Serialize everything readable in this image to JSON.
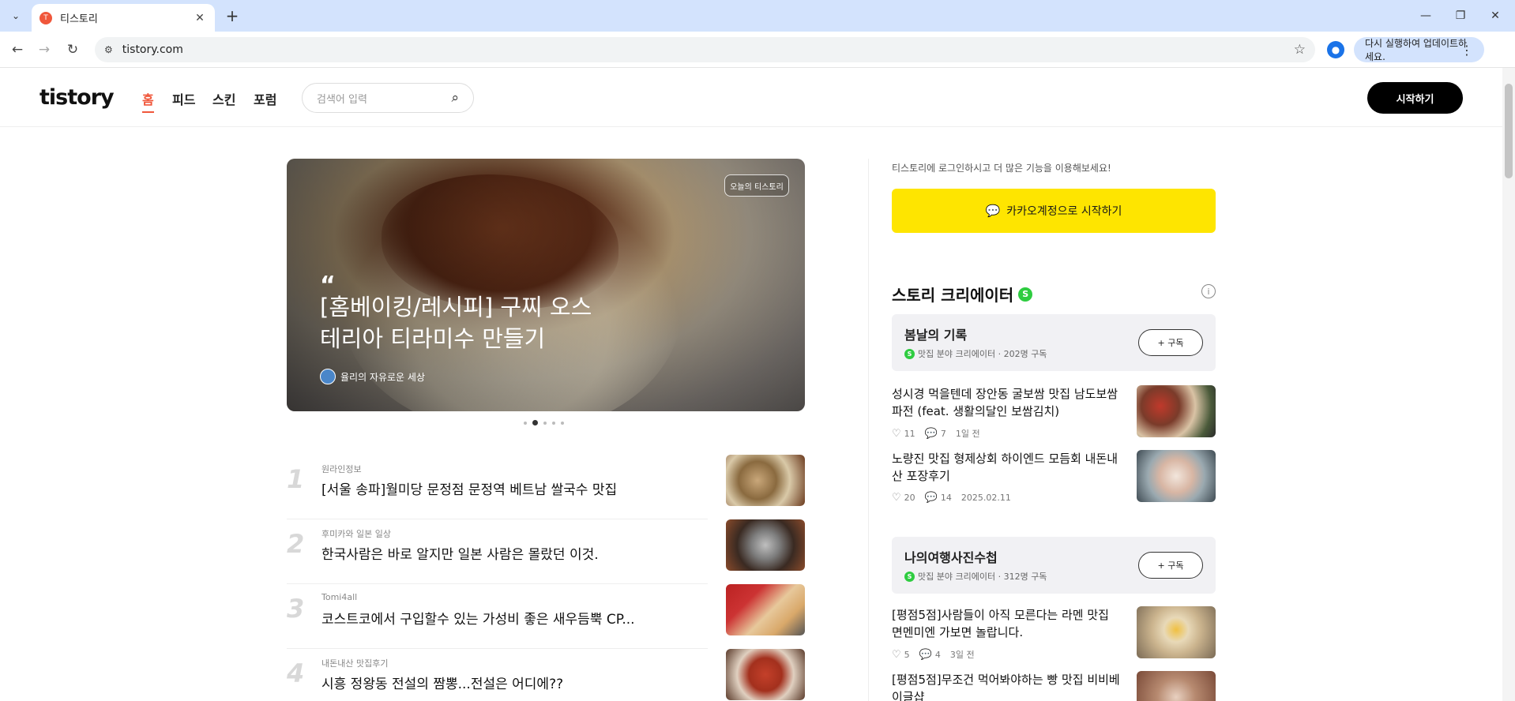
{
  "browser": {
    "tab_title": "티스토리",
    "url": "tistory.com",
    "update_label": "다시 실행하여 업데이트하세요."
  },
  "header": {
    "logo": "tistory",
    "nav": [
      "홈",
      "피드",
      "스킨",
      "포럼"
    ],
    "search_placeholder": "검색어 입력",
    "start_label": "시작하기"
  },
  "hero": {
    "badge": "오늘의 티스토리",
    "quote": "“",
    "title": "[홈베이킹/레시피] 구찌 오스테리아 티라미수 만들기",
    "author": "율리의 자유로운 세상",
    "slide_count": 5,
    "active_slide": 1
  },
  "ranking": [
    {
      "num": "1",
      "category": "원라인정보",
      "title": "[서울 송파]월미당 문정점 문정역 베트남 쌀국수 맛집"
    },
    {
      "num": "2",
      "category": "후미카와 일본 일상",
      "title": "한국사람은 바로 알지만 일본 사람은 몰랐던 이것."
    },
    {
      "num": "3",
      "category": "Tomi4all",
      "title": "코스트코에서 구입할수 있는 가성비 좋은 새우듬뿍 CP..."
    },
    {
      "num": "4",
      "category": "내돈내산 맛집후기",
      "title": "시흥 정왕동 전설의 짬뽕...전설은 어디에??"
    }
  ],
  "sidebar": {
    "login_hint": "티스토리에 로그인하시고 더 많은 기능을 이용해보세요!",
    "kakao_label": "카카오계정으로 시작하기",
    "section_title": "스토리 크리에이터",
    "s_badge": "S",
    "info": "i",
    "creators": [
      {
        "name": "봄날의 기록",
        "field": "맛집 분야 크리에이터",
        "subscribers": "202명 구독",
        "subscribe_label": "+ 구독",
        "posts": [
          {
            "title": "성시경 먹을텐데 장안동 굴보쌈 맛집 남도보쌈 파전 (feat. 생활의달인 보쌈김치)",
            "likes": "11",
            "comments": "7",
            "date": "1일 전"
          },
          {
            "title": "노량진 맛집 형제상회 하이엔드 모듬회 내돈내산 포장후기",
            "likes": "20",
            "comments": "14",
            "date": "2025.02.11"
          }
        ]
      },
      {
        "name": "나의여행사진수첩",
        "field": "맛집 분야 크리에이터",
        "subscribers": "312명 구독",
        "subscribe_label": "+ 구독",
        "posts": [
          {
            "title": "[평점5점]사람들이 아직 모른다는 라멘 맛집 면멘미엔 가보면 놀랍니다.",
            "likes": "5",
            "comments": "4",
            "date": "3일 전"
          },
          {
            "title": "[평점5점]무조건 먹어봐야하는 빵 맛집 비비베이글샵",
            "likes": "",
            "comments": "",
            "date": ""
          }
        ]
      }
    ]
  },
  "colors": {
    "accent": "#f0573b",
    "kakao": "#fee500",
    "creator_badge": "#2ecc40"
  }
}
